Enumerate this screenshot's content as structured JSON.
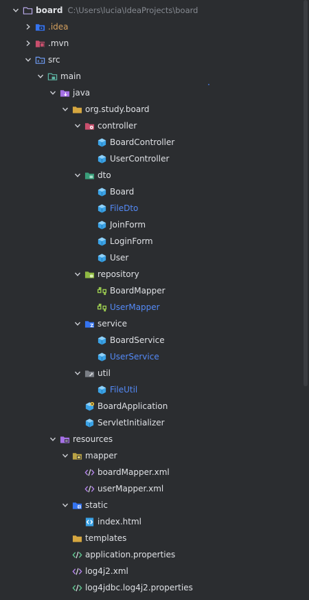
{
  "tree": [
    {
      "label": "board",
      "path": "C:\\Users\\lucia\\IdeaProjects\\board",
      "level": 0,
      "expanded": true,
      "icon": "project-folder-icon",
      "style": "bold"
    },
    {
      "label": ".idea",
      "level": 1,
      "expanded": false,
      "icon": "idea-folder-icon",
      "style": "orange"
    },
    {
      "label": ".mvn",
      "level": 1,
      "expanded": false,
      "icon": "mvn-folder-icon"
    },
    {
      "label": "src",
      "level": 1,
      "expanded": true,
      "icon": "source-root-folder-icon"
    },
    {
      "label": "main",
      "level": 2,
      "expanded": true,
      "icon": "module-folder-icon"
    },
    {
      "label": "java",
      "level": 3,
      "expanded": true,
      "icon": "java-source-folder-icon"
    },
    {
      "label": "org.study.board",
      "level": 4,
      "expanded": true,
      "icon": "package-folder-icon"
    },
    {
      "label": "controller",
      "level": 5,
      "expanded": true,
      "icon": "controller-folder-icon"
    },
    {
      "label": "BoardController",
      "level": 6,
      "icon": "class-icon"
    },
    {
      "label": "UserController",
      "level": 6,
      "icon": "class-icon"
    },
    {
      "label": "dto",
      "level": 5,
      "expanded": true,
      "icon": "dto-folder-icon"
    },
    {
      "label": "Board",
      "level": 6,
      "icon": "class-icon"
    },
    {
      "label": "FileDto",
      "level": 6,
      "icon": "class-icon",
      "style": "blue"
    },
    {
      "label": "JoinForm",
      "level": 6,
      "icon": "class-icon"
    },
    {
      "label": "LoginForm",
      "level": 6,
      "icon": "class-icon"
    },
    {
      "label": "User",
      "level": 6,
      "icon": "class-icon"
    },
    {
      "label": "repository",
      "level": 5,
      "expanded": true,
      "icon": "repository-folder-icon"
    },
    {
      "label": "BoardMapper",
      "level": 6,
      "icon": "mapper-icon"
    },
    {
      "label": "UserMapper",
      "level": 6,
      "icon": "mapper-icon",
      "style": "blue"
    },
    {
      "label": "service",
      "level": 5,
      "expanded": true,
      "icon": "service-folder-icon"
    },
    {
      "label": "BoardService",
      "level": 6,
      "icon": "class-icon"
    },
    {
      "label": "UserService",
      "level": 6,
      "icon": "class-icon",
      "style": "blue"
    },
    {
      "label": "util",
      "level": 5,
      "expanded": true,
      "icon": "util-folder-icon"
    },
    {
      "label": "FileUtil",
      "level": 6,
      "icon": "class-icon",
      "style": "blue"
    },
    {
      "label": "BoardApplication",
      "level": 5,
      "icon": "spring-app-class-icon"
    },
    {
      "label": "ServletInitializer",
      "level": 5,
      "icon": "class-icon"
    },
    {
      "label": "resources",
      "level": 3,
      "expanded": true,
      "icon": "resources-folder-icon"
    },
    {
      "label": "mapper",
      "level": 4,
      "expanded": true,
      "icon": "mapper-folder-icon"
    },
    {
      "label": "boardMapper.xml",
      "level": 5,
      "icon": "xml-file-icon"
    },
    {
      "label": "userMapper.xml",
      "level": 5,
      "icon": "xml-file-icon"
    },
    {
      "label": "static",
      "level": 4,
      "expanded": true,
      "icon": "web-folder-icon"
    },
    {
      "label": "index.html",
      "level": 5,
      "icon": "html-file-icon"
    },
    {
      "label": "templates",
      "level": 4,
      "expanded": false,
      "noChevron": true,
      "icon": "templates-folder-icon"
    },
    {
      "label": "application.properties",
      "level": 4,
      "icon": "properties-file-icon"
    },
    {
      "label": "log4j2.xml",
      "level": 4,
      "icon": "xml-file-icon"
    },
    {
      "label": "log4jdbc.log4j2.properties",
      "level": 4,
      "icon": "properties-file-icon"
    }
  ],
  "colors": {
    "background": "#2b2d30",
    "text": "#dfe1e5",
    "modified_blue": "#548af7",
    "excluded_orange": "#d5a05e",
    "path_gray": "#868a91"
  }
}
